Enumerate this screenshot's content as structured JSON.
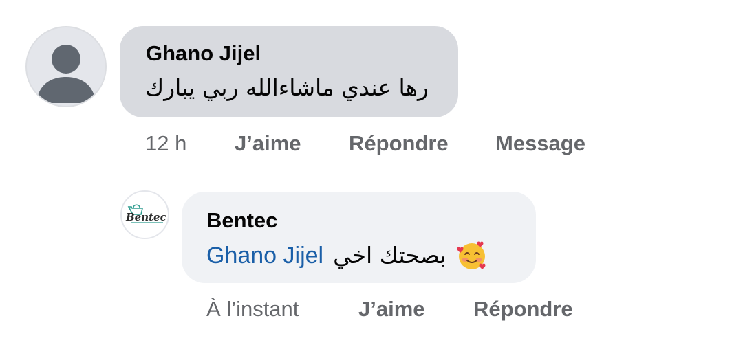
{
  "comments": [
    {
      "author": "Ghano Jijel",
      "text": "رها عندي ماشاءالله  ربي يبارك",
      "avatar_icon": "default-user-silhouette-icon",
      "actions": {
        "time": "12 h",
        "like": "J’aime",
        "reply": "Répondre",
        "message": "Message"
      }
    },
    {
      "author": "Bentec",
      "avatar_logo_text": "Bentec",
      "mention": "Ghano Jijel",
      "text": "بصحتك اخي",
      "emoji": "smiling-face-with-hearts-emoji",
      "actions": {
        "time": "À l’instant",
        "like": "J’aime",
        "reply": "Répondre"
      }
    }
  ],
  "colors": {
    "bubble_primary": "#d8dadf",
    "bubble_secondary": "#f0f2f5",
    "meta_text": "#65676b",
    "mention": "#1a5fa8",
    "logo_teal": "#2e9c8f",
    "logo_text": "#2b2b2b"
  }
}
